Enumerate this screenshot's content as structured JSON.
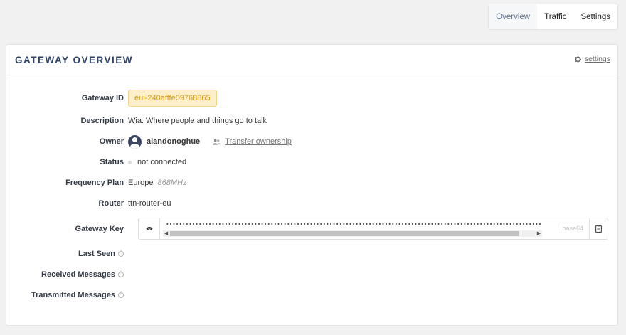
{
  "tabs": [
    {
      "label": "Overview",
      "active": true
    },
    {
      "label": "Traffic",
      "active": false
    },
    {
      "label": "Settings",
      "active": false
    }
  ],
  "card": {
    "title": "GATEWAY OVERVIEW",
    "settings_label": "settings",
    "settings_icon": "gear-icon"
  },
  "fields": {
    "gateway_id": {
      "label": "Gateway ID",
      "value": "eui-240afffe09768865"
    },
    "description": {
      "label": "Description",
      "value": "Wia: Where people and things go to talk"
    },
    "owner": {
      "label": "Owner",
      "value": "alandonoghue",
      "transfer_label": "Transfer ownership"
    },
    "status": {
      "label": "Status",
      "value": "not connected"
    },
    "frequency_plan": {
      "label": "Frequency Plan",
      "value": "Europe",
      "sub": "868MHz"
    },
    "router": {
      "label": "Router",
      "value": "ttn-router-eu"
    },
    "gateway_key": {
      "label": "Gateway Key",
      "format": "base64"
    },
    "last_seen": {
      "label": "Last Seen"
    },
    "received_messages": {
      "label": "Received Messages"
    },
    "transmitted_messages": {
      "label": "Transmitted Messages"
    }
  },
  "colors": {
    "title": "#2f4466",
    "badge_bg": "#fcefc9",
    "badge_text": "#d39a1a",
    "background": "#f1f1f1"
  }
}
